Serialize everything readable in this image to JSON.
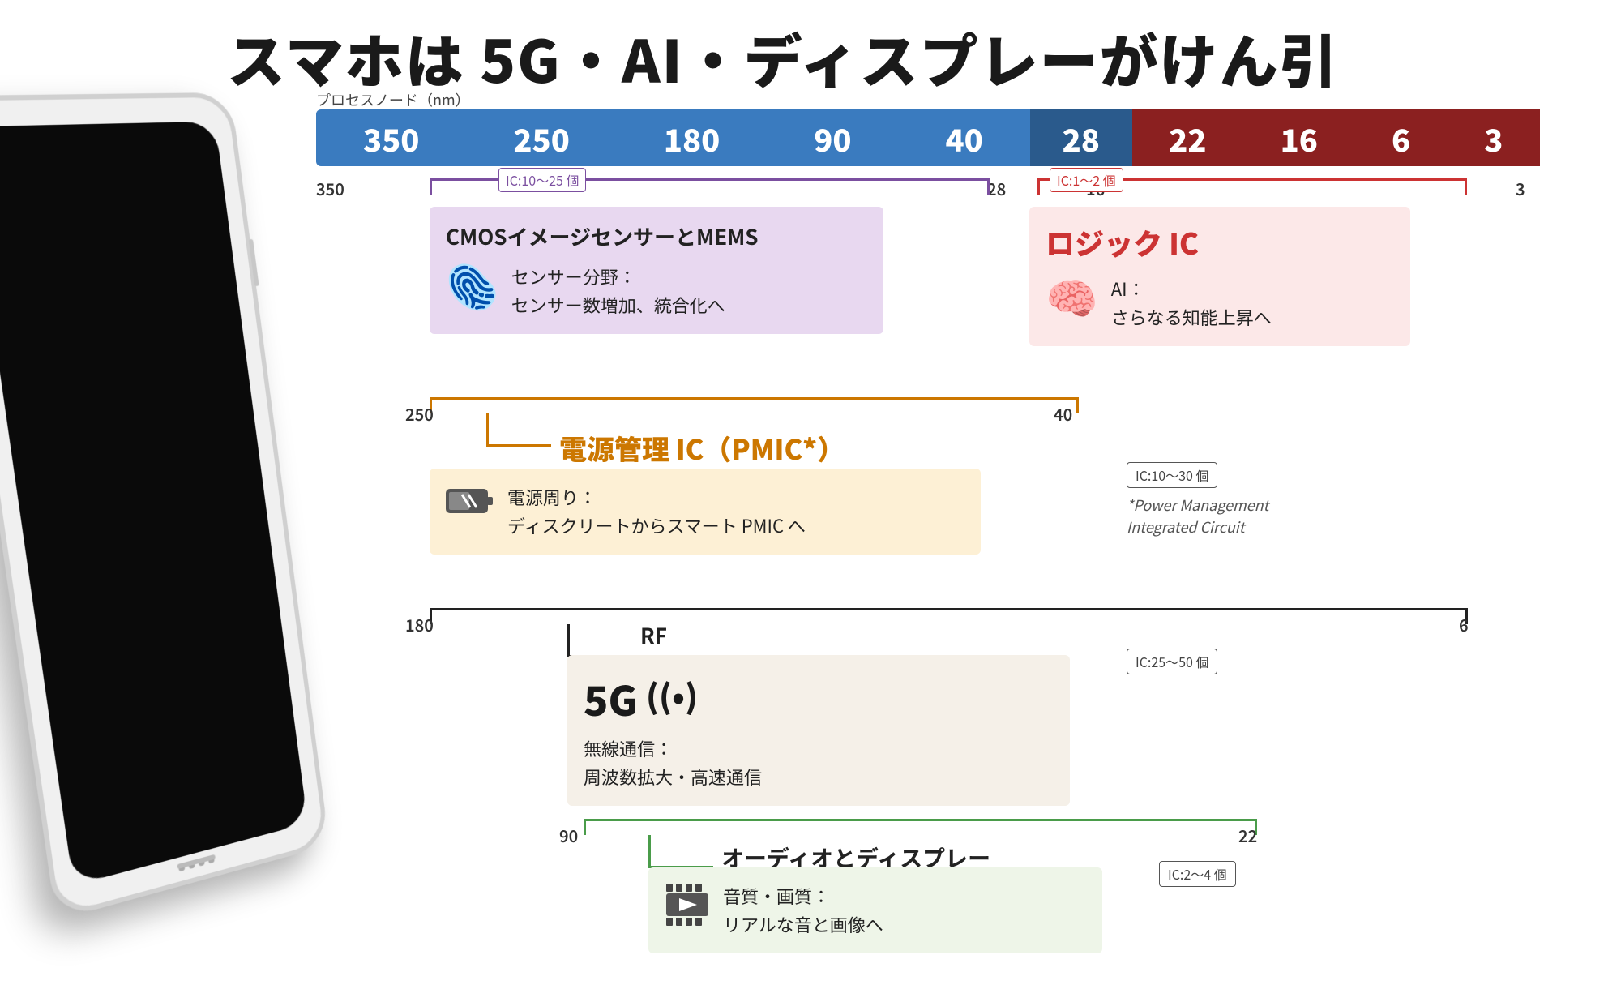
{
  "title": "スマホは 5G・AI・ディスプレーがけん引",
  "subtitle_label": "プロセスノード（nm）",
  "bar": {
    "blue_numbers": [
      "350",
      "250",
      "180",
      "90",
      "40"
    ],
    "transition_number": "28",
    "red_numbers": [
      "22",
      "16",
      "6",
      "3"
    ]
  },
  "scale": {
    "left": "350",
    "mid": "28",
    "right_16": "16",
    "right_3": "3"
  },
  "cmos": {
    "ic_range": "IC:10〜25 個",
    "title": "CMOSイメージセンサーとMEMS",
    "range_left": "350",
    "range_right": "28",
    "field_label": "センサー分野：",
    "field_detail": "センサー数増加、統合化へ"
  },
  "logic": {
    "ic_range": "IC:1〜2 個",
    "title": "ロジック IC",
    "range_left": "16",
    "range_right": "3",
    "field_label": "AI：",
    "field_detail": "さらなる知能上昇へ"
  },
  "pmic": {
    "range_left": "250",
    "range_right": "40",
    "title": "電源管理 IC（PMIC*）",
    "ic_range": "IC:10〜30 個",
    "power_label": "電源周り：",
    "power_detail": "ディスクリートからスマート PMIC へ",
    "footnote_line1": "*Power Management",
    "footnote_line2": "Integrated Circuit"
  },
  "rf": {
    "range_left": "180",
    "range_right": "6",
    "label": "RF",
    "main_title": "5G",
    "ic_range": "IC:25〜50 個",
    "field_label": "無線通信：",
    "field_detail": "周波数拡大・高速通信"
  },
  "audio": {
    "range_left": "90",
    "range_right": "22",
    "label": "オーディオとディスプレー",
    "ic_range": "IC:2〜4 個",
    "field_label": "音質・画質：",
    "field_detail": "リアルな音と画像へ"
  }
}
